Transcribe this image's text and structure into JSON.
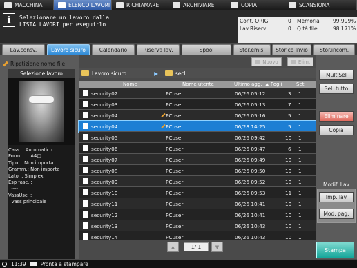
{
  "top_tabs": [
    {
      "label": "MACCHINA",
      "icon": "machine-icon"
    },
    {
      "label": "ELENCO LAVORI",
      "icon": "job-list-icon"
    },
    {
      "label": "RICHIAMARE",
      "icon": "recall-icon"
    },
    {
      "label": "ARCHIVIARE",
      "icon": "store-icon"
    },
    {
      "label": "COPIA",
      "icon": "copy-icon"
    },
    {
      "label": "SCANSIONA",
      "icon": "scan-icon"
    }
  ],
  "message": "Selezionare un lavoro dalla\nLISTA LAVORI per eseguirlo",
  "status_panel": {
    "cont_orig_label": "Cont. ORIG.",
    "cont_orig_value": "0",
    "memoria_label": "Memoria",
    "memoria_value": "99.999%",
    "lav_riserv_label": "Lav.Riserv.",
    "lav_riserv_value": "0",
    "qta_file_label": "Q.tà file",
    "qta_file_value": "98.171%"
  },
  "function_tabs": [
    "Lav.consv.",
    "Lavoro sicuro",
    "Calendario",
    "Riserva lav.",
    "Spool",
    "Stor.emis.",
    "Storico Invio",
    "Stor.incom."
  ],
  "active_tab": "Lavoro sicuro",
  "toolbar": {
    "repeat_label": "Ripetizione nome file",
    "new_label": "Nuovo",
    "delete_label": "Elim."
  },
  "left": {
    "header": "Selezione lavoro",
    "props": "Cass  : Automatico\nForm.  :   A4□\nTipo  : Non importa\nGramm.: Non importa\nLato  : Simplex\nEsp fasc. :\n  ----\nVassUsc  :\n  Vass principale"
  },
  "path": {
    "folder": "Lavoro sicuro",
    "subfolder": "secl"
  },
  "columns": {
    "name": "Nome",
    "user": "Nome utente",
    "date": "Ultimo agg.",
    "sheets": "Fogli",
    "set": "Set"
  },
  "rows": [
    {
      "name": "security02",
      "user": "PCuser",
      "date": "06/26 05:12",
      "sheets": "3",
      "set": "1",
      "pen": false
    },
    {
      "name": "security03",
      "user": "PCuser",
      "date": "06/26 05:13",
      "sheets": "7",
      "set": "1",
      "pen": false
    },
    {
      "name": "security04",
      "user": "PCuser",
      "date": "06/26 05:16",
      "sheets": "5",
      "set": "1",
      "pen": true
    },
    {
      "name": "security04",
      "user": "PCuser",
      "date": "06/28 14:25",
      "sheets": "5",
      "set": "1",
      "pen": true
    },
    {
      "name": "security05",
      "user": "PCuser",
      "date": "06/26 09:42",
      "sheets": "10",
      "set": "1",
      "pen": false
    },
    {
      "name": "security06",
      "user": "PCuser",
      "date": "06/26 09:47",
      "sheets": "6",
      "set": "1",
      "pen": false
    },
    {
      "name": "security07",
      "user": "PCuser",
      "date": "06/26 09:49",
      "sheets": "10",
      "set": "1",
      "pen": false
    },
    {
      "name": "security08",
      "user": "PCuser",
      "date": "06/26 09:50",
      "sheets": "10",
      "set": "1",
      "pen": false
    },
    {
      "name": "security09",
      "user": "PCuser",
      "date": "06/26 09:52",
      "sheets": "10",
      "set": "1",
      "pen": false
    },
    {
      "name": "security10",
      "user": "PCuser",
      "date": "06/26 09:53",
      "sheets": "11",
      "set": "1",
      "pen": false
    },
    {
      "name": "security11",
      "user": "PCuser",
      "date": "06/26 10:41",
      "sheets": "10",
      "set": "1",
      "pen": false
    },
    {
      "name": "security12",
      "user": "PCuser",
      "date": "06/26 10:41",
      "sheets": "10",
      "set": "1",
      "pen": false
    },
    {
      "name": "security13",
      "user": "PCuser",
      "date": "06/26 10:43",
      "sheets": "10",
      "set": "1",
      "pen": false
    },
    {
      "name": "security14",
      "user": "PCuser",
      "date": "06/26 10:43",
      "sheets": "10",
      "set": "1",
      "pen": false
    }
  ],
  "selected_row": 3,
  "right_buttons": {
    "multisel": "MultiSel",
    "sel_tutto": "Sel. tutto",
    "eliminare": "Eliminare",
    "copia": "Copia",
    "modif_label": "Modif. Lav",
    "imp_lav": "Imp. lav",
    "mod_pag": "Mod. pag."
  },
  "pager": {
    "page": "1/ 1"
  },
  "stampa": "Stampa",
  "statusbar": {
    "time": "11:39",
    "text": "Pronta a stampare"
  },
  "colors": {
    "accent": "#1d7fd4",
    "tab_active": "#2f8ad7",
    "delete": "#e06b5f",
    "print": "#16a69a"
  }
}
